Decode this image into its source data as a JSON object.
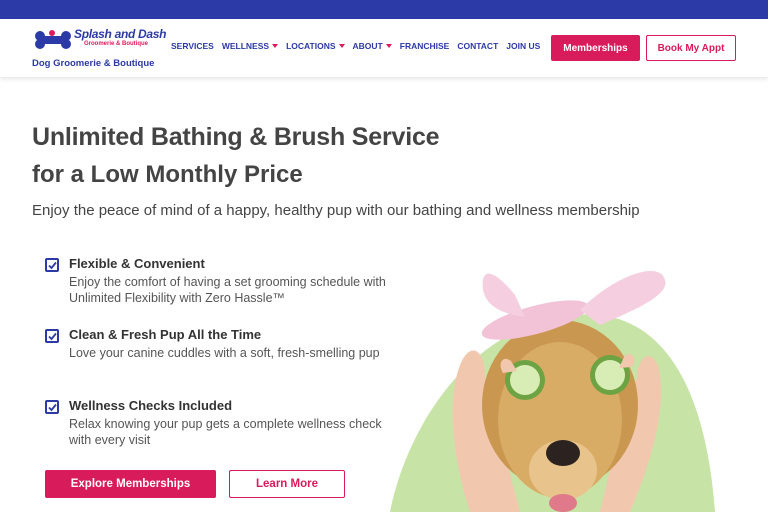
{
  "brand": {
    "name": "Splash and Dash",
    "subname": "Groomerie & Boutique",
    "tagline": "Dog Groomerie & Boutique"
  },
  "nav": {
    "items": [
      {
        "label": "SERVICES",
        "dropdown": false
      },
      {
        "label": "WELLNESS",
        "dropdown": true
      },
      {
        "label": "LOCATIONS",
        "dropdown": true
      },
      {
        "label": "ABOUT",
        "dropdown": true
      },
      {
        "label": "FRANCHISE",
        "dropdown": false
      },
      {
        "label": "CONTACT",
        "dropdown": false
      },
      {
        "label": "JOIN US",
        "dropdown": false
      }
    ],
    "memberships_label": "Memberships",
    "book_label": "Book My Appt"
  },
  "hero": {
    "title": "Unlimited Bathing & Brush Service",
    "subtitle": "for a Low Monthly Price",
    "lead": "Enjoy the peace of mind of a happy, healthy pup with our bathing and wellness membership",
    "features": [
      {
        "title": "Flexible & Convenient",
        "desc": "Enjoy the comfort of having a set grooming schedule with Unlimited Flexibility with Zero Hassle™"
      },
      {
        "title": "Clean & Fresh Pup All the Time",
        "desc": "Love your canine cuddles with a soft, fresh-smelling pup"
      },
      {
        "title": "Wellness Checks Included",
        "desc": "Relax knowing your pup gets a complete wellness check with every visit"
      }
    ],
    "explore_label": "Explore Memberships",
    "learn_label": "Learn More"
  },
  "colors": {
    "brand_blue": "#2b3aa6",
    "brand_pink": "#d81b5a",
    "hero_green": "#c8e3a6"
  },
  "icons": [
    "logo-bone-icon",
    "checkbox-icon",
    "caret-down-icon"
  ]
}
